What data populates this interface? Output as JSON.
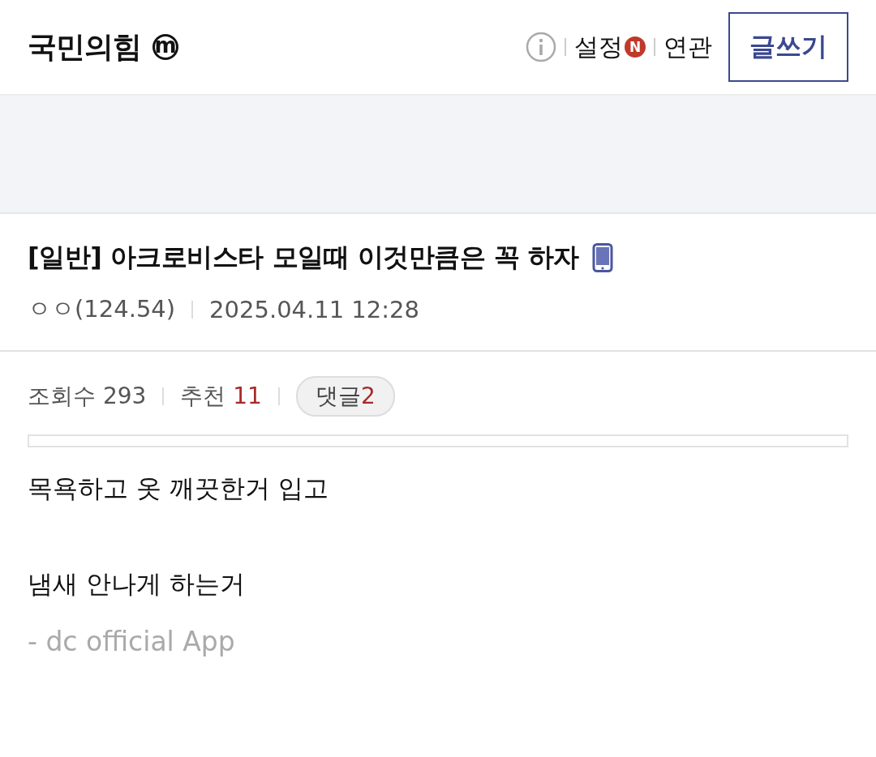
{
  "header": {
    "gallery_title": "국민의힘",
    "gallery_badge": "m",
    "links": [
      {
        "label": "설정",
        "badge": "N"
      },
      {
        "label": "연관"
      }
    ],
    "write_button": "글쓰기"
  },
  "post": {
    "title": "[일반] 아크로비스타 모일때 이것만큼은 꼭 하자",
    "writer": "ㅇㅇ(124.54)",
    "date": "2025.04.11 12:28",
    "stats": [
      {
        "label": "조회수",
        "value": "293",
        "kind": "plain"
      },
      {
        "label": "추천",
        "value": "11",
        "kind": "highlight"
      },
      {
        "label": "댓글",
        "value": "2",
        "kind": "pill"
      }
    ],
    "paragraphs": [
      "목욕하고 옷 깨끗한거 입고",
      "냄새 안나게 하는거"
    ],
    "signature": "- dc official App"
  }
}
